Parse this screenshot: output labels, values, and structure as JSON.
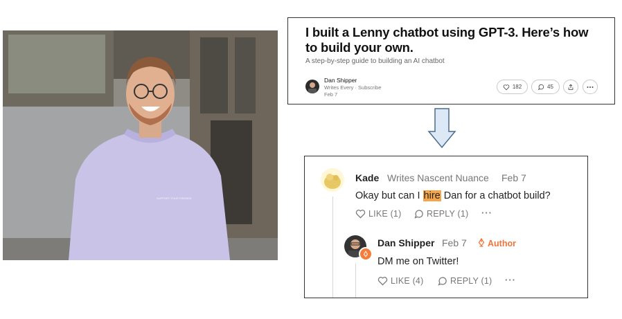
{
  "post": {
    "title": "I built a Lenny chatbot using GPT-3. Here’s how to build your own.",
    "subtitle": "A step-by-step guide to building an AI chatbot",
    "author": "Dan Shipper",
    "publication": "Writes Every · Subscribe",
    "date": "Feb 7",
    "likes": "182",
    "comments": "45",
    "icons": {
      "like": "heart-icon",
      "comment": "comment-bubble-icon",
      "share": "share-icon",
      "more": "more-icon"
    }
  },
  "photo": {
    "shirt_text": "SUPPORT YOUR FRIENDS"
  },
  "comments": [
    {
      "name": "Kade",
      "publication": "Writes Nascent Nuance",
      "date": "Feb 7",
      "body_before": "Okay but can I ",
      "body_highlight": "hire",
      "body_after": " Dan for a chatbot build?",
      "like_label": "LIKE (1)",
      "reply_label": "REPLY (1)",
      "more_label": "···"
    },
    {
      "name": "Dan Shipper",
      "date": "Feb 7",
      "badge": "Author",
      "body": "DM me on Twitter!",
      "like_label": "LIKE (4)",
      "reply_label": "REPLY (1)",
      "more_label": "···"
    }
  ],
  "colors": {
    "highlight": "#f5a64b",
    "author_accent": "#f0743a",
    "arrow_fill": "#dce8f5",
    "arrow_stroke": "#4a6b8c"
  }
}
